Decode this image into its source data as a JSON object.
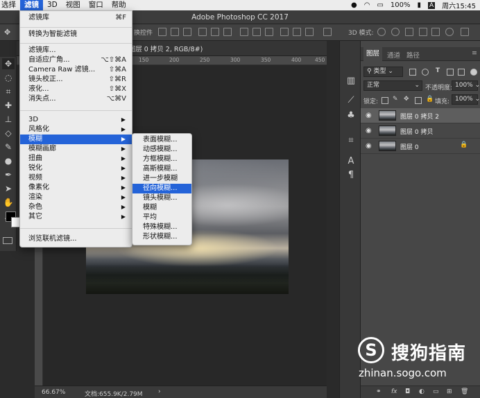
{
  "menubar": {
    "items": [
      "选择",
      "滤镜",
      "3D",
      "视图",
      "窗口",
      "帮助"
    ],
    "battery": "100%",
    "input_method": "A",
    "clock": "周六15:45"
  },
  "window": {
    "title": "Adobe Photoshop CC 2017"
  },
  "options_bar": {
    "fragment": "换控件",
    "mode_label": "3D 模式:"
  },
  "document": {
    "tab_title": "(图层 0 拷贝 2, RGB/8#)",
    "ruler_ticks": [
      "150",
      "200",
      "250",
      "300",
      "350",
      "400",
      "450"
    ],
    "zoom": "66.67%",
    "doc_info": "文档:655.9K/2.79M"
  },
  "filter_menu": {
    "items": [
      {
        "label": "滤镜库",
        "shortcut": "⌘F"
      },
      {
        "label": "转换为智能滤镜",
        "shortcut": ""
      },
      {
        "label": "滤镜库...",
        "shortcut": ""
      },
      {
        "label": "自适应广角...",
        "shortcut": "⌥⇧⌘A"
      },
      {
        "label": "Camera Raw 滤镜...",
        "shortcut": "⇧⌘A"
      },
      {
        "label": "镜头校正...",
        "shortcut": "⇧⌘R"
      },
      {
        "label": "液化...",
        "shortcut": "⇧⌘X"
      },
      {
        "label": "消失点...",
        "shortcut": "⌥⌘V"
      },
      {
        "label": "3D"
      },
      {
        "label": "风格化"
      },
      {
        "label": "模糊"
      },
      {
        "label": "模糊画廊"
      },
      {
        "label": "扭曲"
      },
      {
        "label": "锐化"
      },
      {
        "label": "视频"
      },
      {
        "label": "像素化"
      },
      {
        "label": "渲染"
      },
      {
        "label": "杂色"
      },
      {
        "label": "其它"
      },
      {
        "label": "浏览联机滤镜..."
      }
    ]
  },
  "blur_menu": {
    "items": [
      "表面模糊...",
      "动感模糊...",
      "方框模糊...",
      "高斯模糊...",
      "进一步模糊",
      "径向模糊...",
      "镜头模糊...",
      "模糊",
      "平均",
      "特殊模糊...",
      "形状模糊..."
    ],
    "highlighted": "径向模糊..."
  },
  "layers_panel": {
    "tabs": [
      "图层",
      "通道",
      "路径"
    ],
    "kind_filter": "类型",
    "blend_mode": "正常",
    "opacity_label": "不透明度:",
    "opacity": "100%",
    "lock_label": "锁定:",
    "fill_label": "填充:",
    "fill": "100%",
    "layers": [
      {
        "name": "图层 0 拷贝 2",
        "active": true
      },
      {
        "name": "图层 0 拷贝",
        "active": false
      },
      {
        "name": "图层 0",
        "active": false,
        "locked": true
      }
    ],
    "bottom_fx": "fx"
  },
  "watermark": {
    "logo_letter": "S",
    "text": "搜狗指南",
    "url": "zhinan.sogo.com"
  }
}
